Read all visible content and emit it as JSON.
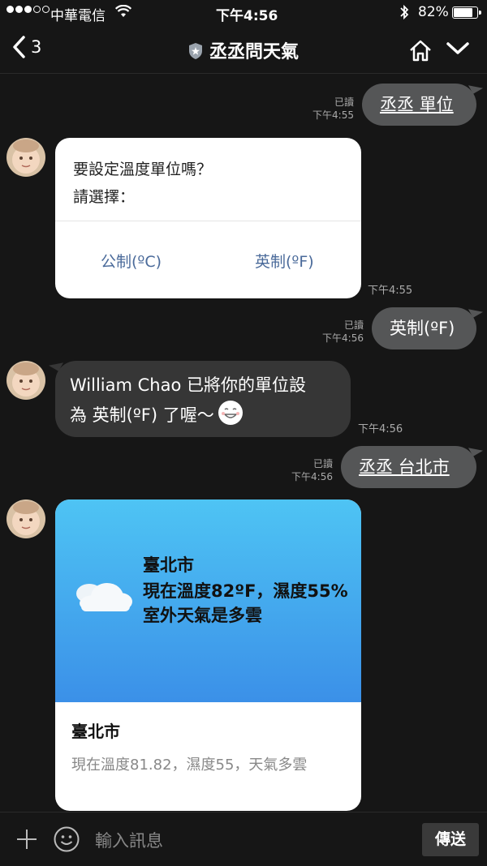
{
  "status_bar": {
    "carrier": "中華電信",
    "time": "下午4:56",
    "battery": "82%",
    "battery_level": 0.82
  },
  "nav": {
    "back_count": "3",
    "title": "丞丞問天氣"
  },
  "messages": {
    "m1": {
      "text": "丞丞 單位",
      "read": "已讀",
      "time": "下午4:55"
    },
    "m2": {
      "question": "要設定溫度單位嗎？",
      "prompt": "請選擇：",
      "option1": "公制(ºC)",
      "option2": "英制(ºF)",
      "time": "下午4:55"
    },
    "m3": {
      "text": "英制(ºF)",
      "read": "已讀",
      "time": "下午4:56"
    },
    "m4": {
      "line1": "William Chao 已將你的單位設",
      "line2": "為 英制(ºF) 了喔～",
      "time": "下午4:56"
    },
    "m5": {
      "text": "丞丞 台北市",
      "read": "已讀",
      "time": "下午4:56"
    },
    "m6": {
      "city": "臺北市",
      "line1": "現在溫度82ºF，濕度55%",
      "line2": "室外天氣是多雲",
      "caption": "臺北市",
      "desc": "現在溫度81.82，濕度55，天氣多雲"
    }
  },
  "input": {
    "placeholder": "輸入訊息",
    "send_label": "傳送"
  }
}
